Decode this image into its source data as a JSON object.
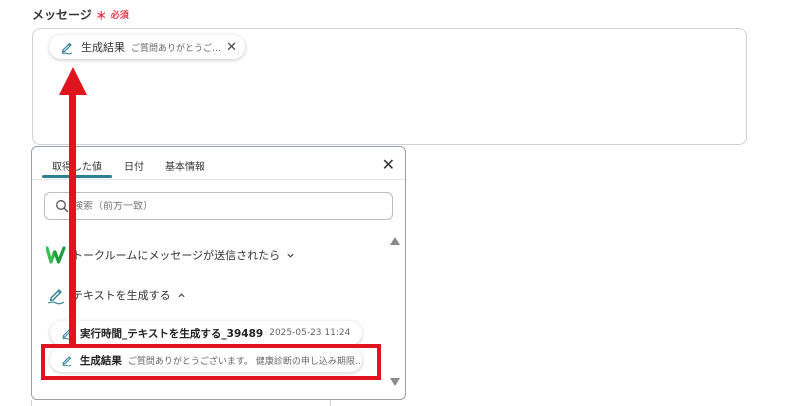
{
  "field": {
    "label": "メッセージ",
    "required_mark": "＊",
    "required_text": "必須"
  },
  "chip": {
    "icon": "pen-icon",
    "label": "生成結果",
    "value": "ご質問ありがとうご…"
  },
  "popup": {
    "tabs": [
      "取得した値",
      "日付",
      "基本情報"
    ],
    "active_tab": 0,
    "close_icon": "close-icon",
    "search_placeholder": "検索（前方一致）",
    "sections": [
      {
        "icon": "w-app-logo-icon",
        "label": "トークルームにメッセージが送信されたら",
        "state": "collapsed"
      },
      {
        "icon": "pen-icon",
        "label": "テキストを生成する",
        "state": "expanded"
      }
    ],
    "items": [
      {
        "label": "実行時間_テキストを生成する_39489",
        "value": "2025-05-23 11:24"
      },
      {
        "label": "生成結果",
        "value": "ご質問ありがとうございます。 健康診断の申し込み期限…"
      }
    ]
  },
  "colors": {
    "accent": "#2d7f94",
    "annotation": "#e0141e",
    "required": "#e8394d"
  }
}
